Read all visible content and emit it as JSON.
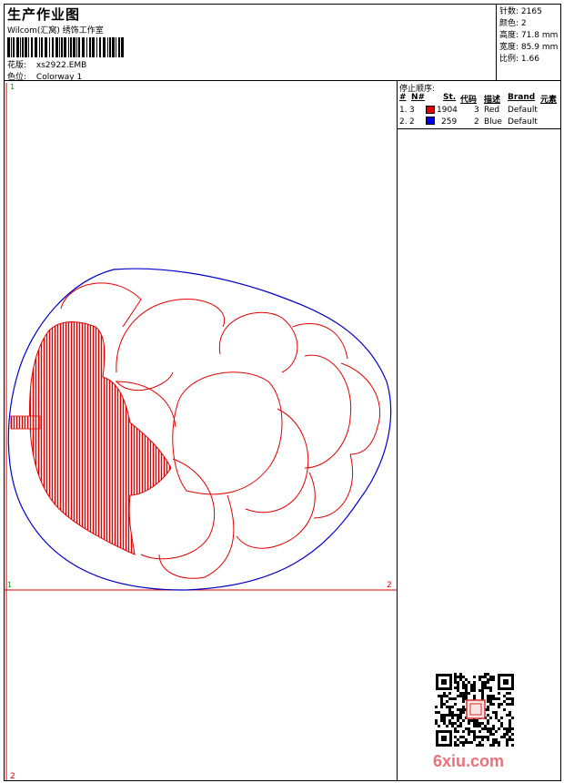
{
  "header": {
    "title": "生产作业图",
    "company": "Wilcom(汇窝)    绣饰工作室",
    "design_label": "花版:",
    "design_value": "xs2922.EMB",
    "colorway_label": "色位:",
    "colorway_value": "Colorway 1"
  },
  "stats": [
    {
      "label": "针数:",
      "value": "2165"
    },
    {
      "label": "颜色:",
      "value": "2"
    },
    {
      "label": "高度:",
      "value": "71.8 mm"
    },
    {
      "label": "宽度:",
      "value": "85.9 mm"
    },
    {
      "label": "比例:",
      "value": "1.66"
    }
  ],
  "stop_sequence": {
    "title": "停止顺序:",
    "columns": [
      "#",
      "N#",
      "St.",
      "代码",
      "描述",
      "Brand",
      "元素"
    ],
    "rows": [
      {
        "index": "1.",
        "needle": "3",
        "stitches": "1904",
        "code": "3",
        "description": "Red",
        "brand": "Default",
        "color": "#e00000"
      },
      {
        "index": "2.",
        "needle": "2",
        "stitches": "259",
        "code": "2",
        "description": "Blue",
        "brand": "Default",
        "color": "#0000e0"
      }
    ]
  },
  "canvas": {
    "markers": [
      "1",
      "1",
      "2",
      "2"
    ],
    "thread_colors": {
      "red": "#e00000",
      "blue": "#0000c8"
    }
  },
  "watermark": "6xiu.com"
}
